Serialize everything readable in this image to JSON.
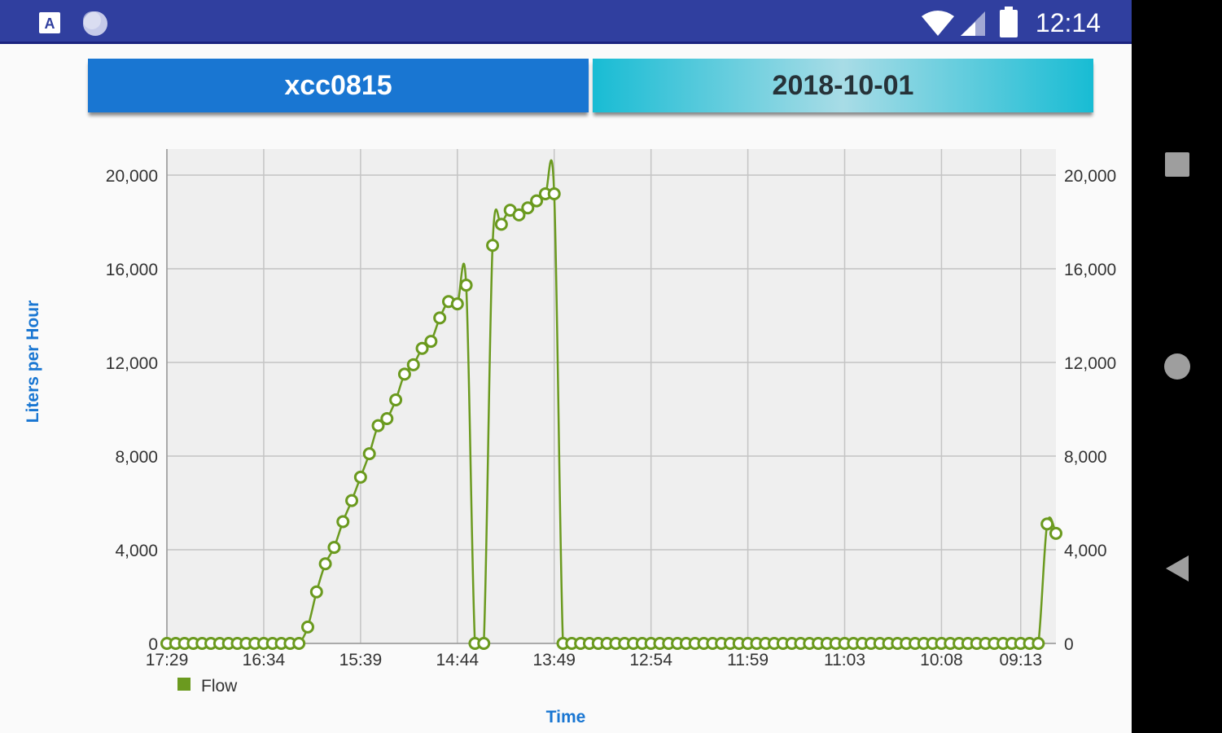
{
  "status_bar": {
    "time": "12:14",
    "icons": [
      "a-icon",
      "circle-icon",
      "wifi-icon",
      "signal-icon",
      "battery-icon"
    ]
  },
  "header": {
    "device_tab": "xcc0815",
    "date_tab": "2018-10-01"
  },
  "chart_data": {
    "type": "line",
    "xlabel": "Time",
    "ylabel": "Liters per Hour",
    "x_tick_labels": [
      "17:29",
      "16:34",
      "15:39",
      "14:44",
      "13:49",
      "12:54",
      "11:59",
      "11:03",
      "10:08",
      "09:13"
    ],
    "y_ticks": [
      0,
      4000,
      8000,
      12000,
      16000,
      20000
    ],
    "y_tick_labels": [
      "0",
      "4,000",
      "8,000",
      "12,000",
      "16,000",
      "20,000"
    ],
    "ylim": [
      0,
      21000
    ],
    "grid": true,
    "legend_position": "bottom-left",
    "x_axis_direction": "time descending left to right, ~5 minute intervals",
    "series": [
      {
        "name": "Flow",
        "color": "#6b9a1f",
        "values": [
          0,
          0,
          0,
          0,
          0,
          0,
          0,
          0,
          0,
          0,
          0,
          0,
          0,
          0,
          0,
          0,
          700,
          2200,
          3400,
          4100,
          5200,
          6100,
          7100,
          8100,
          9300,
          9600,
          10400,
          11500,
          11900,
          12600,
          12900,
          13900,
          14600,
          14500,
          15300,
          0,
          0,
          17000,
          17900,
          18500,
          18300,
          18600,
          18900,
          19200,
          19200,
          0,
          0,
          0,
          0,
          0,
          0,
          0,
          0,
          0,
          0,
          0,
          0,
          0,
          0,
          0,
          0,
          0,
          0,
          0,
          0,
          0,
          0,
          0,
          0,
          0,
          0,
          0,
          0,
          0,
          0,
          0,
          0,
          0,
          0,
          0,
          0,
          0,
          0,
          0,
          0,
          0,
          0,
          0,
          0,
          0,
          0,
          0,
          0,
          0,
          0,
          0,
          0,
          0,
          0,
          0,
          5100,
          4700
        ]
      }
    ]
  }
}
